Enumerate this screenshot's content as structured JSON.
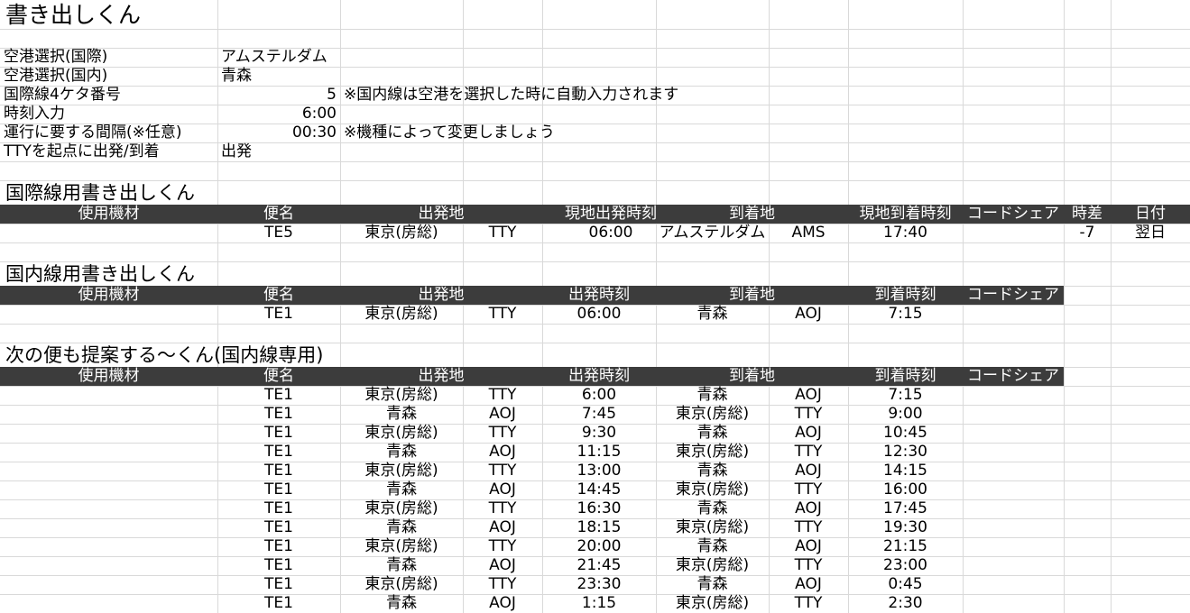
{
  "title": "書き出しくん",
  "settings": {
    "rows": [
      {
        "label": "空港選択(国際)",
        "value": "アムステルダム",
        "note": ""
      },
      {
        "label": "空港選択(国内)",
        "value": "青森",
        "note": ""
      },
      {
        "label": "国際線4ケタ番号",
        "value": "5",
        "note": "※国内線は空港を選択した時に自動入力されます"
      },
      {
        "label": "時刻入力",
        "value": "6:00",
        "note": ""
      },
      {
        "label": "運行に要する間隔(※任意)",
        "value": "00:30",
        "note": "※機種によって変更しましょう"
      },
      {
        "label": "TTYを起点に出発/到着",
        "value": "出発",
        "note": ""
      }
    ]
  },
  "intl": {
    "title": "国際線用書き出しくん",
    "headers": {
      "equipment": "使用機材",
      "flight": "便名",
      "origin": "出発地",
      "dep_time": "現地出発時刻",
      "dest": "到着地",
      "arr_time": "現地到着時刻",
      "codeshare": "コードシェア",
      "tz": "時差",
      "date": "日付"
    },
    "row": {
      "equipment": "",
      "flight": "TE5",
      "origin": "東京(房総)",
      "origin_code": "TTY",
      "dep_time": "06:00",
      "dest": "アムステルダム",
      "dest_code": "AMS",
      "arr_time": "17:40",
      "codeshare": "",
      "tz": "-7",
      "date": "翌日"
    }
  },
  "dom": {
    "title": "国内線用書き出しくん",
    "headers": {
      "equipment": "使用機材",
      "flight": "便名",
      "origin": "出発地",
      "dep_time": "出発時刻",
      "dest": "到着地",
      "arr_time": "到着時刻",
      "codeshare": "コードシェア"
    },
    "row": {
      "equipment": "",
      "flight": "TE1",
      "origin": "東京(房総)",
      "origin_code": "TTY",
      "dep_time": "06:00",
      "dest": "青森",
      "dest_code": "AOJ",
      "arr_time": "7:15",
      "codeshare": ""
    }
  },
  "next": {
    "title": "次の便も提案する～くん(国内線専用)",
    "headers": {
      "equipment": "使用機材",
      "flight": "便名",
      "origin": "出発地",
      "dep_time": "出発時刻",
      "dest": "到着地",
      "arr_time": "到着時刻",
      "codeshare": "コードシェア"
    },
    "rows": [
      {
        "flight": "TE1",
        "origin": "東京(房総)",
        "origin_code": "TTY",
        "dep_time": "6:00",
        "dest": "青森",
        "dest_code": "AOJ",
        "arr_time": "7:15"
      },
      {
        "flight": "TE1",
        "origin": "青森",
        "origin_code": "AOJ",
        "dep_time": "7:45",
        "dest": "東京(房総)",
        "dest_code": "TTY",
        "arr_time": "9:00"
      },
      {
        "flight": "TE1",
        "origin": "東京(房総)",
        "origin_code": "TTY",
        "dep_time": "9:30",
        "dest": "青森",
        "dest_code": "AOJ",
        "arr_time": "10:45"
      },
      {
        "flight": "TE1",
        "origin": "青森",
        "origin_code": "AOJ",
        "dep_time": "11:15",
        "dest": "東京(房総)",
        "dest_code": "TTY",
        "arr_time": "12:30"
      },
      {
        "flight": "TE1",
        "origin": "東京(房総)",
        "origin_code": "TTY",
        "dep_time": "13:00",
        "dest": "青森",
        "dest_code": "AOJ",
        "arr_time": "14:15"
      },
      {
        "flight": "TE1",
        "origin": "青森",
        "origin_code": "AOJ",
        "dep_time": "14:45",
        "dest": "東京(房総)",
        "dest_code": "TTY",
        "arr_time": "16:00"
      },
      {
        "flight": "TE1",
        "origin": "東京(房総)",
        "origin_code": "TTY",
        "dep_time": "16:30",
        "dest": "青森",
        "dest_code": "AOJ",
        "arr_time": "17:45"
      },
      {
        "flight": "TE1",
        "origin": "青森",
        "origin_code": "AOJ",
        "dep_time": "18:15",
        "dest": "東京(房総)",
        "dest_code": "TTY",
        "arr_time": "19:30"
      },
      {
        "flight": "TE1",
        "origin": "東京(房総)",
        "origin_code": "TTY",
        "dep_time": "20:00",
        "dest": "青森",
        "dest_code": "AOJ",
        "arr_time": "21:15"
      },
      {
        "flight": "TE1",
        "origin": "青森",
        "origin_code": "AOJ",
        "dep_time": "21:45",
        "dest": "東京(房総)",
        "dest_code": "TTY",
        "arr_time": "23:00"
      },
      {
        "flight": "TE1",
        "origin": "東京(房総)",
        "origin_code": "TTY",
        "dep_time": "23:30",
        "dest": "青森",
        "dest_code": "AOJ",
        "arr_time": "0:45"
      },
      {
        "flight": "TE1",
        "origin": "青森",
        "origin_code": "AOJ",
        "dep_time": "1:15",
        "dest": "東京(房総)",
        "dest_code": "TTY",
        "arr_time": "2:30"
      }
    ]
  }
}
